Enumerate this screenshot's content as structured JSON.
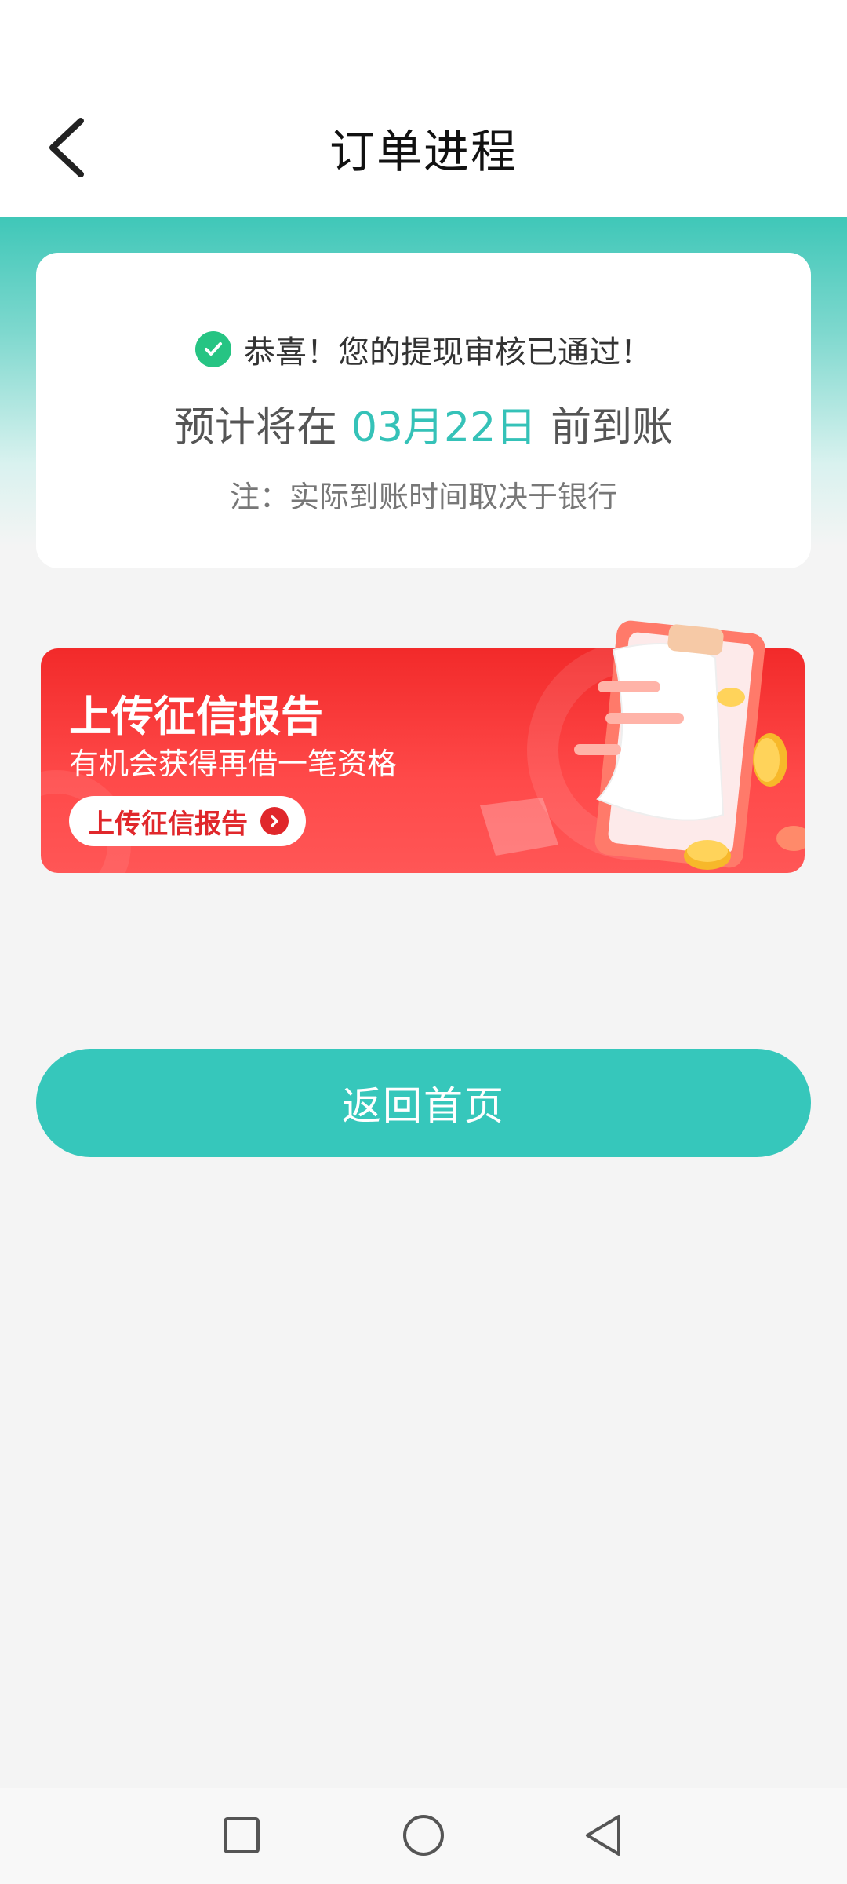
{
  "header": {
    "title": "订单进程",
    "back_icon": "chevron-left-icon"
  },
  "status_card": {
    "success_text": "恭喜！您的提现审核已通过！",
    "eta_prefix": "预计将在",
    "eta_date": "03月22日",
    "eta_suffix": "前到账",
    "note": "注：实际到账时间取决于银行"
  },
  "promo": {
    "title": "上传征信报告",
    "subtitle": "有机会获得再借一笔资格",
    "button_label": "上传征信报告"
  },
  "home_button_label": "返回首页",
  "colors": {
    "accent_teal": "#36c7bb",
    "success_green": "#26c483",
    "promo_red": "#f22a2a",
    "date_teal": "#35c2b8"
  },
  "system_nav": {
    "icons": [
      "square-recents-icon",
      "circle-home-icon",
      "triangle-back-icon"
    ]
  }
}
